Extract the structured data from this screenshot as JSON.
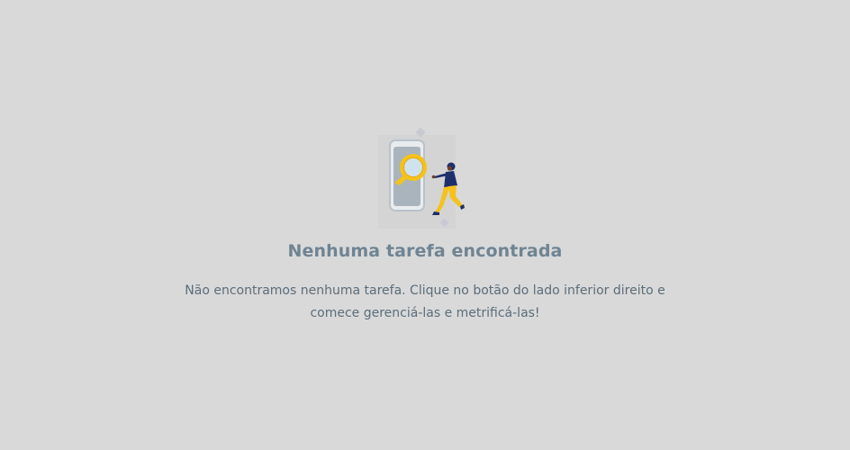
{
  "empty_state": {
    "illustration": "search-phone-illustration",
    "title": "Nenhuma tarefa encontrada",
    "message": "Não encontramos nenhuma tarefa. Clique no botão do lado inferior direito e comece gerenciá-las e metrificá-las!"
  },
  "colors": {
    "background": "#d9d9d9",
    "title": "#6f8493",
    "message": "#5c6d79",
    "accent_yellow": "#f5c21b",
    "accent_navy": "#1e2f6b"
  }
}
